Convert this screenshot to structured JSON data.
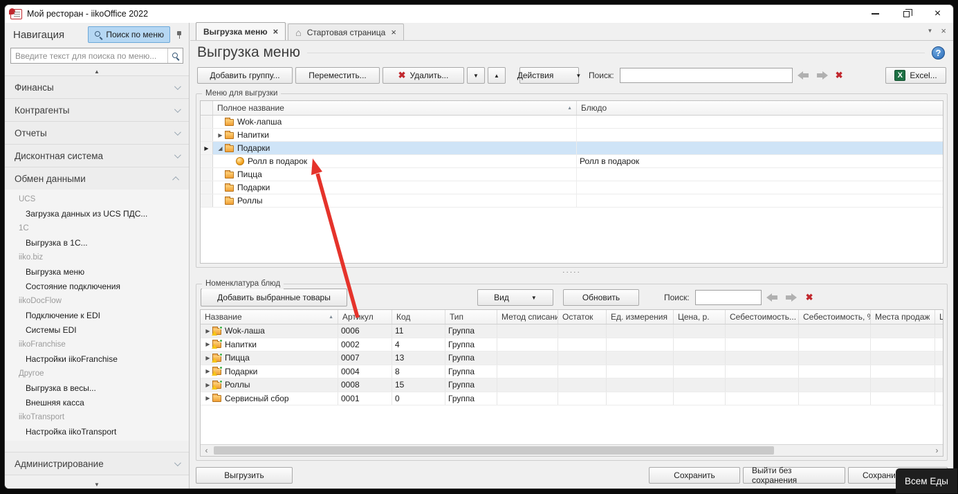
{
  "window": {
    "title": "Мой ресторан - iikoOffice 2022"
  },
  "sidebar": {
    "header": "Навигация",
    "search_menu_button": "Поиск по меню",
    "search_placeholder": "Введите текст для поиска по меню...",
    "sections": [
      {
        "label": "Финансы",
        "expanded": false
      },
      {
        "label": "Контрагенты",
        "expanded": false
      },
      {
        "label": "Отчеты",
        "expanded": false
      },
      {
        "label": "Дисконтная система",
        "expanded": false
      },
      {
        "label": "Обмен данными",
        "expanded": true,
        "groups": [
          {
            "header": "UCS",
            "items": [
              "Загрузка данных из UCS ПДС..."
            ]
          },
          {
            "header": "1C",
            "items": [
              "Выгрузка в 1С..."
            ]
          },
          {
            "header": "iiko.biz",
            "items": [
              "Выгрузка меню",
              "Состояние подключения"
            ]
          },
          {
            "header": "iikoDocFlow",
            "items": [
              "Подключение к EDI",
              "Системы EDI"
            ]
          },
          {
            "header": "iikoFranchise",
            "items": [
              "Настройки iikoFranchise"
            ]
          },
          {
            "header": "Другое",
            "items": [
              "Выгрузка в весы...",
              "Внешняя касса"
            ]
          },
          {
            "header": "iikoTransport",
            "items": [
              "Настройка iikoTransport"
            ]
          }
        ]
      },
      {
        "label": "Администрирование",
        "expanded": false
      }
    ]
  },
  "tabs": [
    {
      "label": "Выгрузка меню",
      "active": true
    },
    {
      "label": "Стартовая страница",
      "active": false
    }
  ],
  "page": {
    "title": "Выгрузка меню"
  },
  "toolbar": {
    "add_group": "Добавить группу...",
    "move": "Переместить...",
    "delete": "Удалить...",
    "actions": "Действия",
    "search_label": "Поиск:",
    "search_value": "",
    "excel": "Excel..."
  },
  "menu_export": {
    "group_title": "Меню для выгрузки",
    "columns": [
      "Полное название",
      "Блюдо"
    ],
    "rows": [
      {
        "name": "Wok-лапша",
        "dish": "",
        "icon": "folder",
        "level": 0,
        "expander": "",
        "selected": false
      },
      {
        "name": "Напитки",
        "dish": "",
        "icon": "folder",
        "level": 0,
        "expander": "collapsed",
        "selected": false
      },
      {
        "name": "Подарки",
        "dish": "",
        "icon": "folder",
        "level": 0,
        "expander": "expanded",
        "selected": true
      },
      {
        "name": "Ролл в подарок",
        "dish": "Ролл в подарок",
        "icon": "dish",
        "level": 1,
        "expander": "",
        "selected": false
      },
      {
        "name": "Пицца",
        "dish": "",
        "icon": "folder",
        "level": 0,
        "expander": "",
        "selected": false
      },
      {
        "name": "Подарки",
        "dish": "",
        "icon": "folder",
        "level": 0,
        "expander": "",
        "selected": false
      },
      {
        "name": "Роллы",
        "dish": "",
        "icon": "folder",
        "level": 0,
        "expander": "",
        "selected": false
      }
    ]
  },
  "nomenclature": {
    "group_title": "Номенклатура блюд",
    "add_selected": "Добавить выбранные товары",
    "view": "Вид",
    "refresh": "Обновить",
    "search_label": "Поиск:",
    "search_value": "",
    "columns": [
      "Название",
      "Артикул",
      "Код",
      "Тип",
      "Метод списания",
      "Остаток",
      "Ед. измерения",
      "Цена, р.",
      "Себестоимость...",
      "Себестоимость, %",
      "Места продаж",
      "Цве"
    ],
    "rows": [
      {
        "name": "Wok-лаша",
        "article": "0006",
        "code": "11",
        "type": "Группа",
        "icon": "folder-warning"
      },
      {
        "name": "Напитки",
        "article": "0002",
        "code": "4",
        "type": "Группа",
        "icon": "folder-warning"
      },
      {
        "name": "Пицца",
        "article": "0007",
        "code": "13",
        "type": "Группа",
        "icon": "folder-warning"
      },
      {
        "name": "Подарки",
        "article": "0004",
        "code": "8",
        "type": "Группа",
        "icon": "folder-warning"
      },
      {
        "name": "Роллы",
        "article": "0008",
        "code": "15",
        "type": "Группа",
        "icon": "folder-warning"
      },
      {
        "name": "Сервисный сбор",
        "article": "0001",
        "code": "0",
        "type": "Группа",
        "icon": "folder"
      }
    ]
  },
  "footer": {
    "upload": "Выгрузить",
    "save": "Сохранить",
    "exit_no_save": "Выйти без сохранения",
    "save_exit": "Сохранить",
    "watermark": "Всем Еды"
  },
  "icons": {
    "sort_ascending": "▲",
    "expand_collapsed": "▶",
    "expand_expanded": "◢",
    "row_selector": "▶",
    "dropdown_arrow": "▼",
    "move_down": "▼",
    "move_up": "▲",
    "delete_x": "✖",
    "clear_x": "✖",
    "close_x": "×",
    "home": "⌂",
    "scroll_up": "▲",
    "scroll_down": "▼",
    "scroll_left": "‹",
    "scroll_right": "›",
    "splitter_dots": "·····",
    "help": "?",
    "excel_x": "X"
  },
  "colors": {
    "selection_blue": "#cfe4f7",
    "annotation_red": "#e5332b",
    "excel_green": "#1e7145",
    "search_button_blue": "#b5d7f3",
    "watermark_dark": "#1e1e1e"
  }
}
